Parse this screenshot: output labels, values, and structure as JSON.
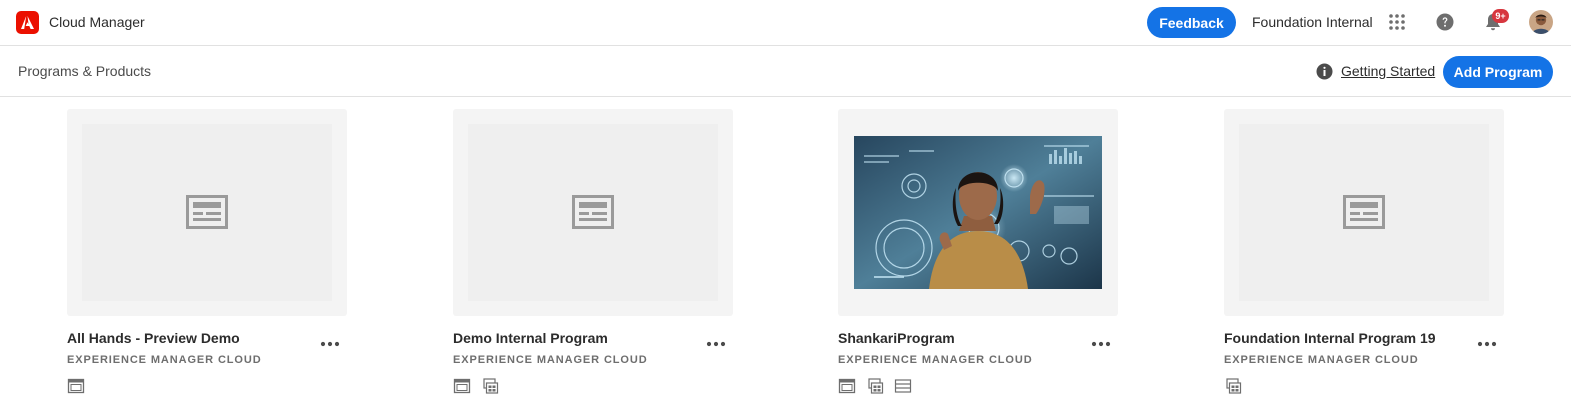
{
  "header": {
    "app_title": "Cloud Manager",
    "feedback_label": "Feedback",
    "org_name": "Foundation Internal",
    "notification_count": "9+",
    "icons": [
      "adobe-logo-icon",
      "apps-grid-icon",
      "help-icon",
      "bell-icon",
      "avatar"
    ]
  },
  "subheader": {
    "breadcrumb": "Programs & Products",
    "getting_started": "Getting Started",
    "add_program": "Add Program"
  },
  "colors": {
    "accent": "#1473e6",
    "brand": "#eb1000",
    "badge": "#d7373f"
  },
  "programs": [
    {
      "name": "All Hands - Preview Demo",
      "product": "EXPERIENCE MANAGER CLOUD",
      "thumbnail": "placeholder",
      "service_icons": [
        "sites-icon"
      ]
    },
    {
      "name": "Demo Internal Program",
      "product": "EXPERIENCE MANAGER CLOUD",
      "thumbnail": "placeholder",
      "service_icons": [
        "sites-icon",
        "assets-icon"
      ]
    },
    {
      "name": "ShankariProgram",
      "product": "EXPERIENCE MANAGER CLOUD",
      "thumbnail": "photo",
      "service_icons": [
        "sites-icon",
        "assets-icon",
        "forms-icon"
      ]
    },
    {
      "name": "Foundation Internal Program 19",
      "product": "EXPERIENCE MANAGER CLOUD",
      "thumbnail": "placeholder",
      "service_icons": [
        "assets-icon"
      ]
    }
  ]
}
